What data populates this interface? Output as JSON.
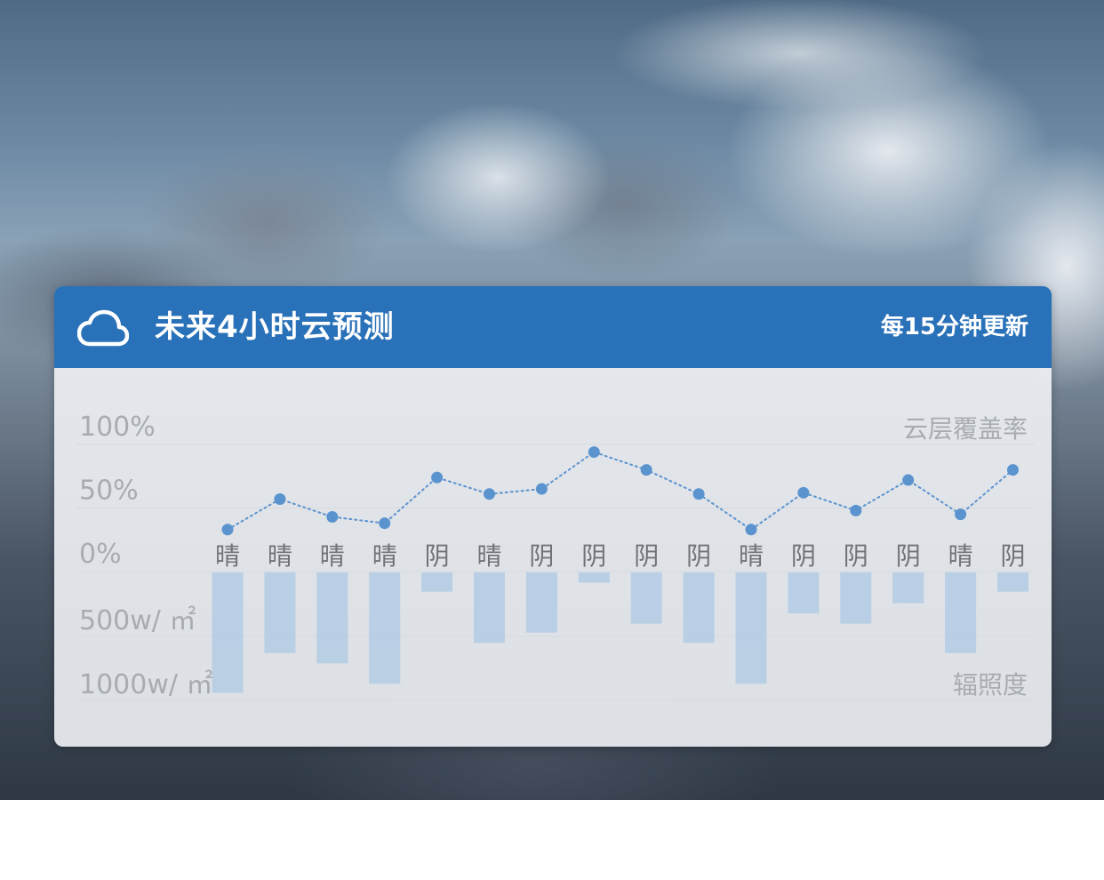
{
  "header": {
    "title": "未来4小时云预测",
    "update_note": "每15分钟更新"
  },
  "colors": {
    "header_bg": "#2971b8",
    "bar": "#b3cbe4",
    "point": "#5b93cf",
    "grid": "#d7dadd",
    "axis_text": "#a8acb0",
    "category_text": "#6f7377"
  },
  "icons": {
    "header": "cloud-icon"
  },
  "chart_data": [
    {
      "type": "line",
      "title": "",
      "ylabel": "云层覆盖率",
      "ylim": [
        0,
        100
      ],
      "ytick_labels": [
        "100%",
        "50%",
        "0%"
      ],
      "yticks": [
        100,
        50,
        0
      ],
      "categories": [
        "晴",
        "晴",
        "晴",
        "晴",
        "阴",
        "晴",
        "阴",
        "阴",
        "阴",
        "阴",
        "晴",
        "阴",
        "阴",
        "阴",
        "晴",
        "阴"
      ],
      "values": [
        33,
        57,
        43,
        38,
        74,
        61,
        65,
        94,
        80,
        61,
        33,
        62,
        48,
        72,
        45,
        80
      ],
      "grid": true
    },
    {
      "type": "bar",
      "ylabel": "辐照度",
      "ylim": [
        0,
        1000
      ],
      "orientation": "downward",
      "ytick_labels": [
        "500w/ ㎡",
        "1000w/ ㎡"
      ],
      "yticks": [
        500,
        1000
      ],
      "categories": [
        "晴",
        "晴",
        "晴",
        "晴",
        "阴",
        "晴",
        "阴",
        "阴",
        "阴",
        "阴",
        "晴",
        "阴",
        "阴",
        "阴",
        "晴",
        "阴"
      ],
      "values": [
        940,
        630,
        710,
        870,
        150,
        550,
        470,
        80,
        400,
        550,
        870,
        320,
        400,
        240,
        630,
        150
      ],
      "grid": true
    }
  ]
}
